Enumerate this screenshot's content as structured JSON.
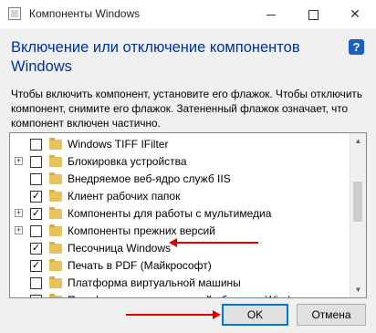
{
  "window": {
    "title": "Компоненты Windows",
    "controls": {
      "minimize": "minimize",
      "maximize": "maximize",
      "close": "✕"
    }
  },
  "header": {
    "heading": "Включение или отключение компонентов Windows",
    "help": "?"
  },
  "description": "Чтобы включить компонент, установите его флажок. Чтобы отключить компонент, снимите его флажок. Затененный флажок означает, что компонент включен частично.",
  "features": [
    {
      "label": "Windows TIFF IFilter",
      "state": "unchecked",
      "expandable": false
    },
    {
      "label": "Блокировка устройства",
      "state": "unchecked",
      "expandable": true
    },
    {
      "label": "Внедряемое веб-ядро служб IIS",
      "state": "unchecked",
      "expandable": false
    },
    {
      "label": "Клиент рабочих папок",
      "state": "checked",
      "expandable": false
    },
    {
      "label": "Компоненты для работы с мультимедиа",
      "state": "checked",
      "expandable": true
    },
    {
      "label": "Компоненты прежних версий",
      "state": "unchecked",
      "expandable": true
    },
    {
      "label": "Песочница Windows",
      "state": "checked",
      "expandable": false
    },
    {
      "label": "Печать в PDF (Майкрософт)",
      "state": "checked",
      "expandable": false
    },
    {
      "label": "Платформа виртуальной машины",
      "state": "unchecked",
      "expandable": false
    },
    {
      "label": "Платформа низкоуровневой оболочки Windows",
      "state": "unchecked",
      "expandable": false
    }
  ],
  "scrollbar": {
    "position_fraction": 0.35
  },
  "buttons": {
    "ok": "OK",
    "cancel": "Отмена"
  },
  "colors": {
    "heading": "#003399",
    "accent": "#0078d7",
    "annotation_arrow": "#e00000",
    "folder": "#e8c25b"
  }
}
